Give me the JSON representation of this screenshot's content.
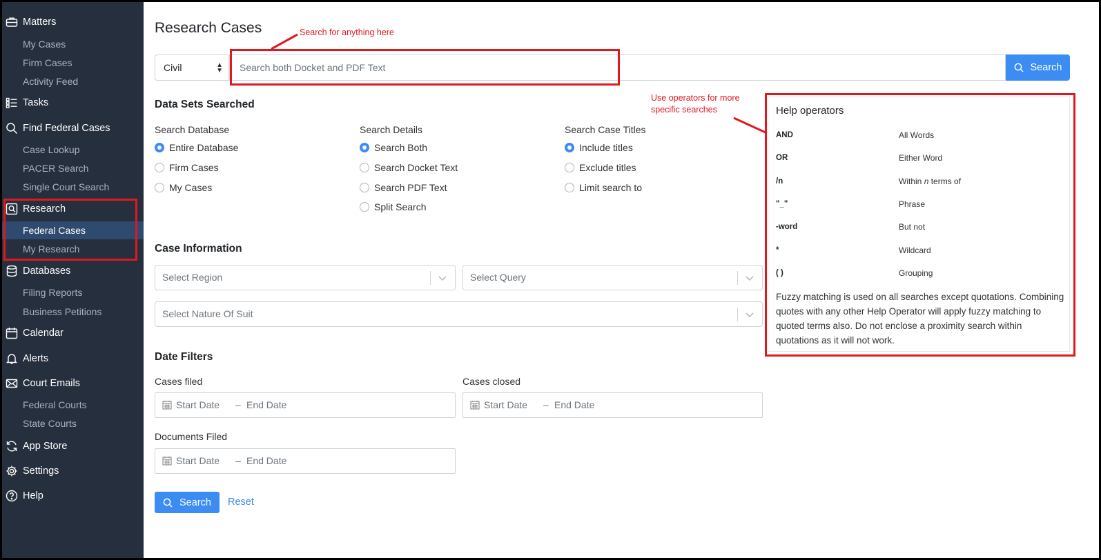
{
  "sidebar": {
    "matters": "Matters",
    "my_cases": "My Cases",
    "firm_cases": "Firm Cases",
    "activity_feed": "Activity Feed",
    "tasks": "Tasks",
    "find_federal_cases": "Find Federal Cases",
    "case_lookup": "Case Lookup",
    "pacer_search": "PACER Search",
    "single_court_search": "Single Court Search",
    "research": "Research",
    "federal_cases": "Federal Cases",
    "my_research": "My Research",
    "databases": "Databases",
    "filing_reports": "Filing Reports",
    "business_petitions": "Business Petitions",
    "calendar": "Calendar",
    "alerts": "Alerts",
    "court_emails": "Court Emails",
    "federal_courts": "Federal Courts",
    "state_courts": "State Courts",
    "app_store": "App Store",
    "settings": "Settings",
    "help": "Help"
  },
  "annotations": {
    "search_hint": "Search for anything here",
    "operators_hint": "Use operators for more specific searches"
  },
  "page": {
    "title": "Research Cases",
    "case_type": "Civil",
    "search_placeholder": "Search both Docket and PDF Text",
    "search_button": "Search"
  },
  "data_sets": {
    "heading": "Data Sets Searched",
    "database": {
      "label": "Search Database",
      "options": [
        "Entire Database",
        "Firm Cases",
        "My Cases"
      ],
      "selected": 0
    },
    "details": {
      "label": "Search Details",
      "options": [
        "Search Both",
        "Search Docket Text",
        "Search PDF Text",
        "Split Search"
      ],
      "selected": 0
    },
    "titles": {
      "label": "Search Case Titles",
      "options": [
        "Include titles",
        "Exclude titles",
        "Limit search to"
      ],
      "selected": 0
    }
  },
  "case_info": {
    "heading": "Case Information",
    "region_placeholder": "Select Region",
    "query_placeholder": "Select Query",
    "nature_placeholder": "Select Nature Of Suit"
  },
  "date_filters": {
    "heading": "Date Filters",
    "cases_filed": "Cases filed",
    "cases_closed": "Cases closed",
    "documents_filed": "Documents Filed",
    "start_date": "Start Date",
    "dash": "–",
    "end_date": "End Date"
  },
  "actions": {
    "search": "Search",
    "reset": "Reset"
  },
  "help": {
    "title": "Help operators",
    "operators": [
      {
        "op": "AND",
        "desc_pre": "All Words",
        "desc_em": "",
        "desc_post": ""
      },
      {
        "op": "OR",
        "desc_pre": "Either Word",
        "desc_em": "",
        "desc_post": ""
      },
      {
        "op": "/n",
        "desc_pre": "Within ",
        "desc_em": "n",
        "desc_post": " terms of"
      },
      {
        "op": "\"_\"",
        "desc_pre": "Phrase",
        "desc_em": "",
        "desc_post": ""
      },
      {
        "op": "-word",
        "desc_pre": "But not",
        "desc_em": "",
        "desc_post": ""
      },
      {
        "op": "*",
        "desc_pre": "Wildcard",
        "desc_em": "",
        "desc_post": ""
      },
      {
        "op": "( )",
        "desc_pre": "Grouping",
        "desc_em": "",
        "desc_post": ""
      }
    ],
    "note": "Fuzzy matching is used on all searches except quotations. Combining quotes with any other Help Operator will apply fuzzy matching to quoted terms also. Do not enclose a proximity search within quotations as it will not work."
  },
  "colors": {
    "sidebar_bg": "#262f3d",
    "accent": "#3b8cf3",
    "annotation": "#e0191e"
  }
}
